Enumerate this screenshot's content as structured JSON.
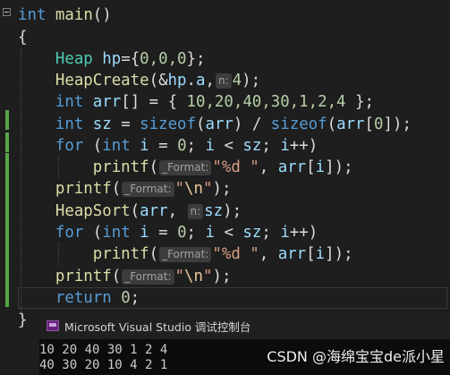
{
  "code": {
    "l1_kw": "int",
    "l1_fn": "main",
    "l1_rest": "()",
    "l2": "{",
    "l3_ty": "Heap",
    "l3_var": "hp",
    "l3_rest1": "={",
    "l3_nums": "0,0,0",
    "l3_rest2": "};",
    "l4_fn": "HeapCreate",
    "l4_p1": "(&",
    "l4_v1": "hp",
    "l4_dot": ".",
    "l4_v2": "a",
    "l4_comma": ",",
    "l4_hint": "n:",
    "l4_num": "4",
    "l4_end": ");",
    "l5_kw": "int",
    "l5_var": "arr",
    "l5_mid": "[] = { ",
    "l5_nums": "10,20,40,30,1,2,4",
    "l5_end": " };",
    "l6_kw": "int",
    "l6_var": "sz",
    "l6_eq": " = ",
    "l6_kw2": "sizeof",
    "l6_p": "(",
    "l6_v2": "arr",
    "l6_div": ") / ",
    "l6_kw3": "sizeof",
    "l6_p2": "(",
    "l6_v3": "arr",
    "l6_b": "[",
    "l6_num": "0",
    "l6_end": "]);",
    "l7_kw": "for",
    "l7_p": " (",
    "l7_kw2": "int",
    "l7_v1": " i",
    "l7_eq": " = ",
    "l7_n": "0",
    "l7_s": "; ",
    "l7_v2": "i",
    "l7_lt": " < ",
    "l7_v3": "sz",
    "l7_s2": "; ",
    "l7_v4": "i",
    "l7_end": "++)",
    "l8_fn": "printf",
    "l8_p": "(",
    "l8_hint": "_Format:",
    "l8_str": "\"%d \"",
    "l8_c": ", ",
    "l8_v": "arr",
    "l8_b": "[",
    "l8_v2": "i",
    "l8_end": "]);",
    "l9_fn": "printf",
    "l9_p": "(",
    "l9_hint": "_Format:",
    "l9_q1": "\"",
    "l9_esc": "\\n",
    "l9_q2": "\"",
    "l9_end": ");",
    "l10_fn": "HeapSort",
    "l10_p": "(",
    "l10_v": "arr",
    "l10_c": ", ",
    "l10_hint": "n:",
    "l10_v2": "sz",
    "l10_end": ");",
    "l11_kw": "for",
    "l11_p": " (",
    "l11_kw2": "int",
    "l11_v1": " i",
    "l11_eq": " = ",
    "l11_n": "0",
    "l11_s": "; ",
    "l11_v2": "i",
    "l11_lt": " < ",
    "l11_v3": "sz",
    "l11_s2": "; ",
    "l11_v4": "i",
    "l11_end": "++)",
    "l12_fn": "printf",
    "l12_p": "(",
    "l12_hint": "_Format:",
    "l12_str": "\"%d \"",
    "l12_c": ", ",
    "l12_v": "arr",
    "l12_b": "[",
    "l12_v2": "i",
    "l12_end": "]);",
    "l13_fn": "printf",
    "l13_p": "(",
    "l13_hint": "_Format:",
    "l13_q1": "\"",
    "l13_esc": "\\n",
    "l13_q2": "\"",
    "l13_end": ");",
    "l14_kw": "return",
    "l14_n": " 0",
    "l14_end": ";",
    "l15": "}"
  },
  "console": {
    "title": "Microsoft Visual Studio 调试控制台",
    "line1": "10 20 40 30 1 2 4",
    "line2": "40 30 20 10 4 2 1"
  },
  "watermark": "CSDN @海绵宝宝de派小星",
  "colors": {
    "keyword": "#569cd6",
    "function": "#dcdcaa",
    "type": "#4ec9b0",
    "variable": "#9cdcfe",
    "number": "#b5cea8",
    "string": "#d69d85",
    "changed_bar": "#57a64a"
  }
}
